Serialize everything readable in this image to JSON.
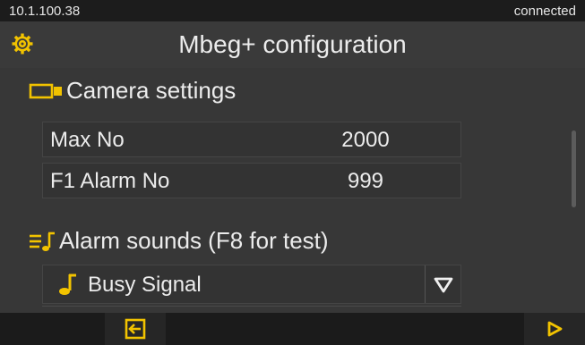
{
  "status": {
    "ip": "10.1.100.38",
    "connection": "connected"
  },
  "header": {
    "title": "Mbeg+ configuration",
    "icon": "gear-icon"
  },
  "camera": {
    "heading": "Camera settings",
    "icon": "camera-icon",
    "rows": [
      {
        "label": "Max No",
        "value": "2000"
      },
      {
        "label": "F1 Alarm No",
        "value": "999"
      }
    ]
  },
  "alarm": {
    "heading": "Alarm sounds (F8 for test)",
    "icon": "music-list-icon",
    "selected": "Busy Signal",
    "selected_icon": "music-note-icon",
    "dropdown_icon": "triangle-down-icon"
  },
  "toolbar": {
    "back_icon": "exit-arrow-icon",
    "next_icon": "play-icon"
  },
  "colors": {
    "accent": "#f2c300",
    "bg": "#373737",
    "text": "#ececec",
    "bar": "#1b1b1b"
  }
}
